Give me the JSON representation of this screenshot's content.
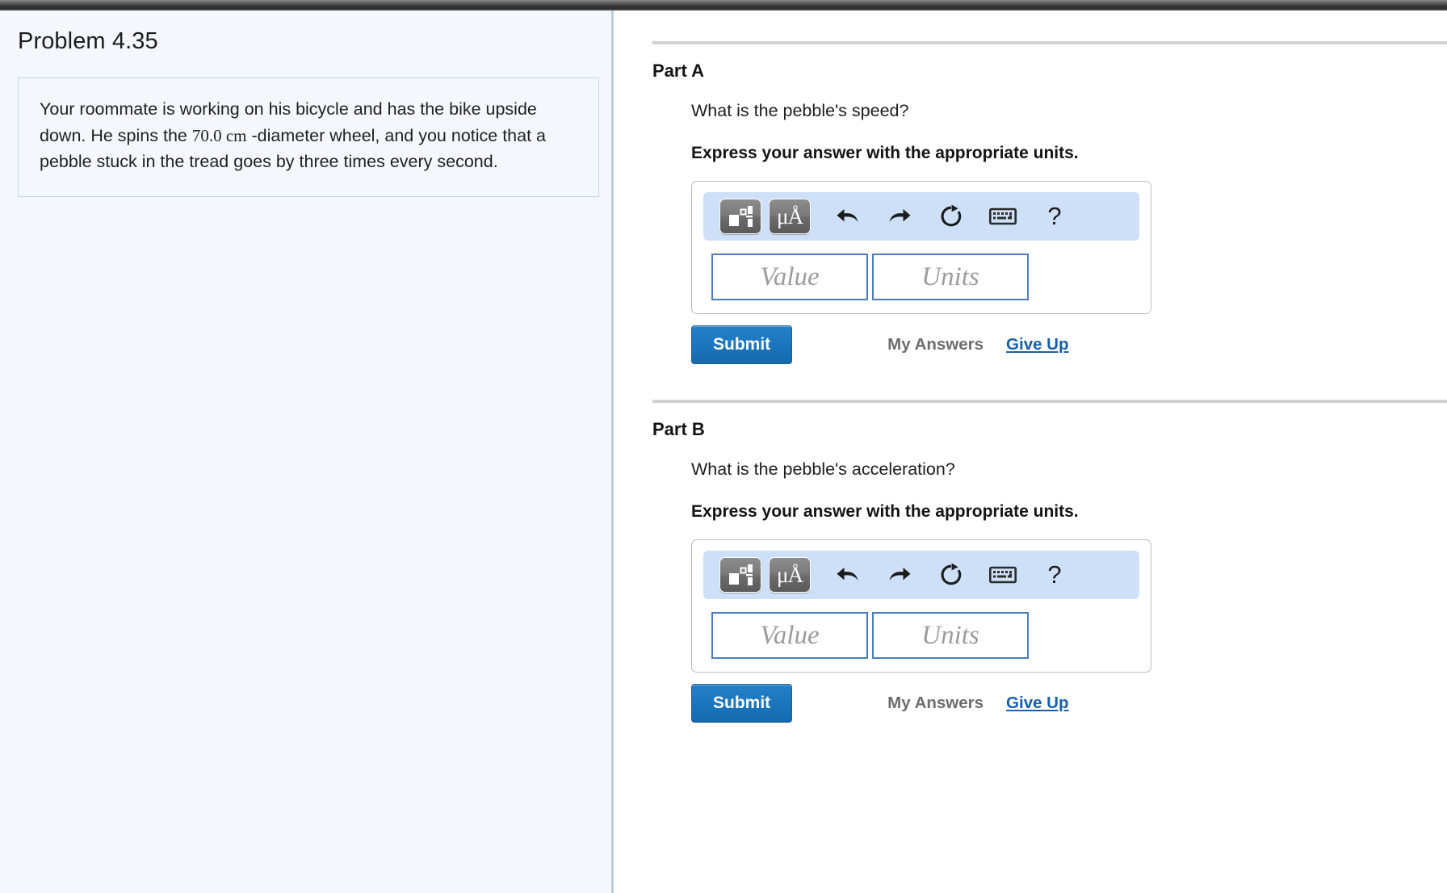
{
  "problem": {
    "title": "Problem 4.35",
    "statement_pre": "Your roommate is working on his bicycle and has the bike upside down. He spins the ",
    "statement_value": "70.0 cm",
    "statement_post": " -diameter wheel, and you notice that a pebble stuck in the tread goes by three times every second."
  },
  "parts": [
    {
      "label": "Part A",
      "question": "What is the pebble's speed?",
      "instruction": "Express your answer with the appropriate units.",
      "toolbar": {
        "template_button": "template-icon",
        "units_button": "μÅ",
        "undo": "undo-icon",
        "redo": "redo-icon",
        "reset": "reset-icon",
        "keyboard": "keyboard-icon",
        "help": "?"
      },
      "value_placeholder": "Value",
      "units_placeholder": "Units",
      "value": "",
      "units": "",
      "submit_label": "Submit",
      "my_answers_label": "My Answers",
      "give_up_label": "Give Up"
    },
    {
      "label": "Part B",
      "question": "What is the pebble's acceleration?",
      "instruction": "Express your answer with the appropriate units.",
      "toolbar": {
        "template_button": "template-icon",
        "units_button": "μÅ",
        "undo": "undo-icon",
        "redo": "redo-icon",
        "reset": "reset-icon",
        "keyboard": "keyboard-icon",
        "help": "?"
      },
      "value_placeholder": "Value",
      "units_placeholder": "Units",
      "value": "",
      "units": "",
      "submit_label": "Submit",
      "my_answers_label": "My Answers",
      "give_up_label": "Give Up"
    }
  ],
  "colors": {
    "panel_bg": "#f4f8fd",
    "panel_border": "#c3d4e5",
    "divider": "#b8cde2",
    "toolbar_bg": "#cde0f7",
    "input_border": "#4a7ebb",
    "submit_bg": "#1b76bd",
    "link": "#1a5fa8",
    "muted_text": "#6d6d6d",
    "rule": "#d2d2d2"
  }
}
